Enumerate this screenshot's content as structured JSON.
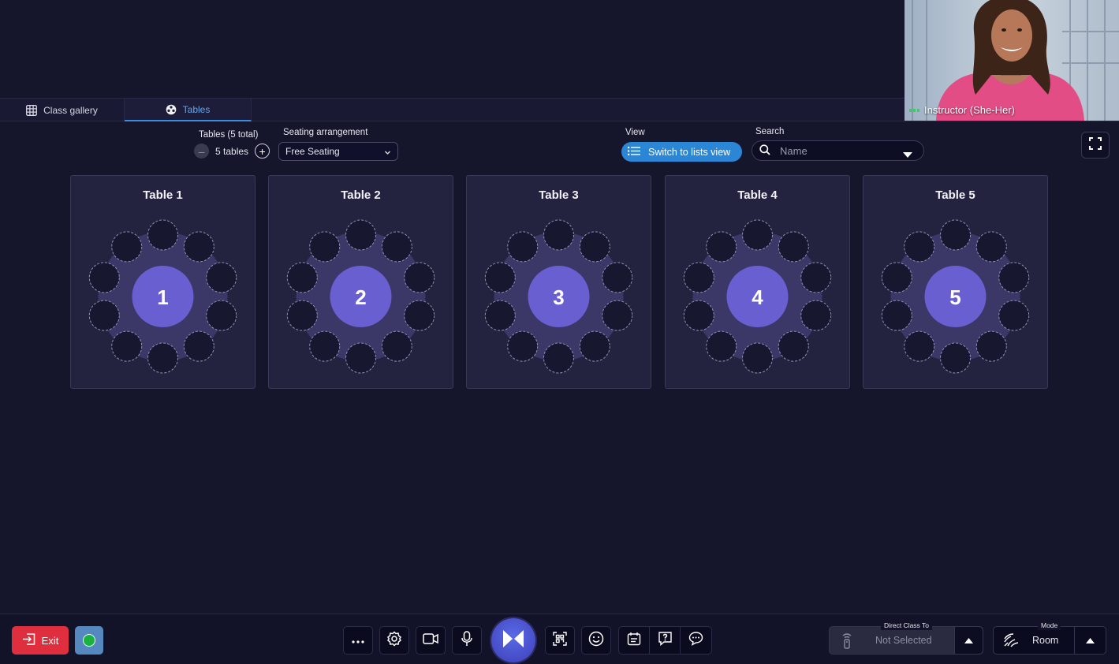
{
  "tabs": [
    {
      "label": "Class gallery",
      "icon": "grid-icon"
    },
    {
      "label": "Tables",
      "icon": "tables-icon",
      "active": true
    }
  ],
  "video": {
    "name": "Instructor (She-Her)"
  },
  "controls": {
    "tables_label": "Tables (5 total)",
    "tables_value": "5 tables",
    "seating_label": "Seating arrangement",
    "seating_value": "Free Seating",
    "view_label": "View",
    "view_button": "Switch to lists view",
    "search_label": "Search",
    "search_placeholder": "Name"
  },
  "tables": [
    {
      "title": "Table 1",
      "number": "1",
      "seats": 10
    },
    {
      "title": "Table 2",
      "number": "2",
      "seats": 10
    },
    {
      "title": "Table 3",
      "number": "3",
      "seats": 10
    },
    {
      "title": "Table 4",
      "number": "4",
      "seats": 10
    },
    {
      "title": "Table 5",
      "number": "5",
      "seats": 10
    }
  ],
  "bottom": {
    "exit_label": "Exit",
    "direct_label": "Direct Class To",
    "direct_value": "Not Selected",
    "mode_label": "Mode",
    "mode_value": "Room"
  },
  "colors": {
    "background": "#15152c",
    "accent_blue": "#2b86d6",
    "table_center": "#6a5fd1",
    "exit_red": "#df2f3e",
    "status_green": "#19b241"
  }
}
